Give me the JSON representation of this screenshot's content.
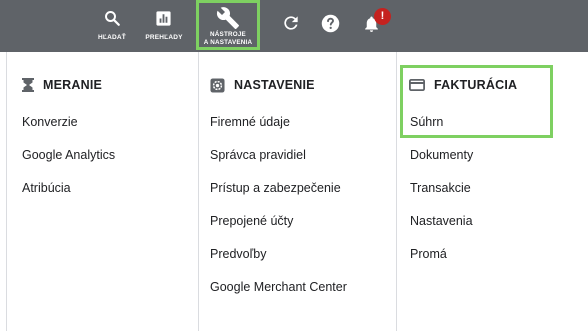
{
  "topbar": {
    "search_label": "HĽADAŤ",
    "reports_label": "PREHĽADY",
    "tools_label_line1": "NÁSTROJE",
    "tools_label_line2": "A NASTAVENIA",
    "notification_badge": "!",
    "icons": [
      "search-icon",
      "bar-chart-icon",
      "wrench-icon",
      "refresh-icon",
      "help-icon",
      "bell-icon"
    ]
  },
  "columns": [
    {
      "title": "MERANIE",
      "icon": "hourglass-icon",
      "items": [
        "Konverzie",
        "Google Analytics",
        "Atribúcia"
      ]
    },
    {
      "title": "NASTAVENIE",
      "icon": "settings-icon",
      "items": [
        "Firemné údaje",
        "Správca pravidiel",
        "Prístup a zabezpečenie",
        "Prepojené účty",
        "Predvoľby",
        "Google Merchant Center"
      ]
    },
    {
      "title": "FAKTURÁCIA",
      "icon": "credit-card-icon",
      "items": [
        "Súhrn",
        "Dokumenty",
        "Transakcie",
        "Nastavenia",
        "Promá"
      ]
    }
  ],
  "colors": {
    "topbar_bg": "#5f6368",
    "highlight": "#7ed061",
    "badge": "#c5221f",
    "divider": "#dadce0"
  }
}
